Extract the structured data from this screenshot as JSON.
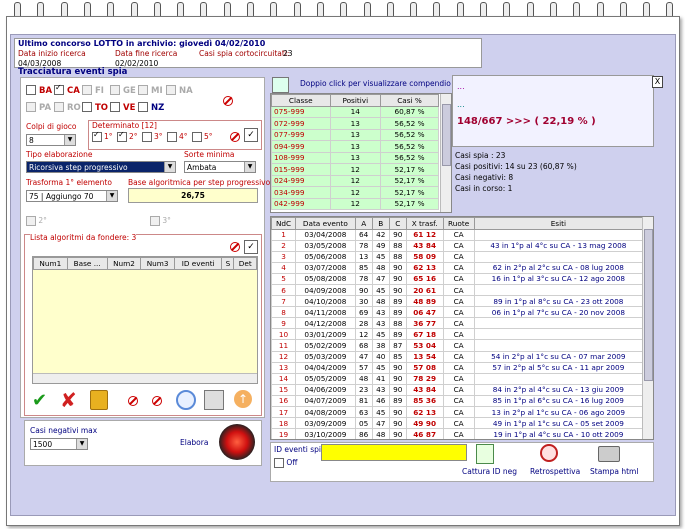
{
  "header": {
    "title": "Ultimo concorso LOTTO in archivio: giovedì 04/02/2010",
    "start_label": "Data inizio ricerca",
    "start_value": "04/03/2008",
    "end_label": "Data fine ricerca",
    "end_value": "02/02/2010",
    "short_label": "Casi spia cortocircuitati:",
    "short_value": "23"
  },
  "section_title": "Tracciatura eventi spia",
  "wheels_row1": [
    {
      "name": "BA",
      "checked": false,
      "active": true
    },
    {
      "name": "CA",
      "checked": true,
      "active": true
    },
    {
      "name": "FI",
      "checked": false,
      "active": false
    },
    {
      "name": "GE",
      "checked": false,
      "active": false
    },
    {
      "name": "MI",
      "checked": false,
      "active": false
    },
    {
      "name": "NA",
      "checked": false,
      "active": false
    }
  ],
  "wheels_row2": [
    {
      "name": "PA",
      "checked": false,
      "active": false
    },
    {
      "name": "RO",
      "checked": false,
      "active": false
    },
    {
      "name": "TO",
      "checked": false,
      "active": true
    },
    {
      "name": "VE",
      "checked": false,
      "active": true
    },
    {
      "name": "NZ",
      "checked": false,
      "active": true,
      "blue": true
    }
  ],
  "colpi_label": "Colpi di gioco",
  "colpi_value": "8",
  "determinato_label": "Determinato [12]",
  "determinato_opts": [
    {
      "label": "1°",
      "checked": true
    },
    {
      "label": "2°",
      "checked": true
    },
    {
      "label": "3°",
      "checked": false
    },
    {
      "label": "4°",
      "checked": false
    },
    {
      "label": "5°",
      "checked": false
    }
  ],
  "tipo_label": "Tipo elaborazione",
  "tipo_value": "Ricorsiva step progressivo",
  "sorte_label": "Sorte minima",
  "sorte_value": "Ambata",
  "trasforma_label": "Trasforma 1° elemento",
  "trasforma_value": "75 | Aggiungo 70",
  "base_label": "Base algoritmica per step progressivo",
  "base_value": "26,75",
  "opt2": "2°",
  "opt3": "3°",
  "lista_label": "Lista algoritmi da fondere: 3",
  "lista_cols": [
    "Num1",
    "Base ...",
    "Num2",
    "Num3",
    "ID eventi",
    "S",
    "Det"
  ],
  "casi_neg_label": "Casi negativi max",
  "casi_neg_value": "1500",
  "elabora_label": "Elabora",
  "compendio_label": "Doppio click per visualizzare compendio",
  "cls_cols": [
    "Classe",
    "Positivi",
    "Casi %"
  ],
  "cls_rows": [
    [
      "075-999",
      "14",
      "60,87 %"
    ],
    [
      "072-999",
      "13",
      "56,52 %"
    ],
    [
      "077-999",
      "13",
      "56,52 %"
    ],
    [
      "094-999",
      "13",
      "56,52 %"
    ],
    [
      "108-999",
      "13",
      "56,52 %"
    ],
    [
      "015-999",
      "12",
      "52,17 %"
    ],
    [
      "024-999",
      "12",
      "52,17 %"
    ],
    [
      "034-999",
      "12",
      "52,17 %"
    ],
    [
      "042-999",
      "12",
      "52,17 %"
    ]
  ],
  "summary": {
    "dots1": "...",
    "dots2": "...",
    "result": "148/667 >>> ( 22,19 % )",
    "close": "X"
  },
  "stats": [
    "Casi spia : 23",
    "Casi positivi: 14 su 23 (60,87 %)",
    "Casi negativi: 8",
    "Casi in corso: 1"
  ],
  "ev_cols": [
    "NdC",
    "Data evento",
    "A",
    "B",
    "C",
    "X trasf.",
    "Ruote",
    "Esiti"
  ],
  "ev_rows": [
    [
      "1",
      "03/04/2008",
      "64",
      "42",
      "90",
      "61 12",
      "CA",
      ""
    ],
    [
      "2",
      "03/05/2008",
      "78",
      "49",
      "88",
      "43 84",
      "CA",
      "43 in 1°p al 4°c su CA - 13 mag 2008"
    ],
    [
      "3",
      "05/06/2008",
      "13",
      "45",
      "88",
      "58 09",
      "CA",
      ""
    ],
    [
      "4",
      "03/07/2008",
      "85",
      "48",
      "90",
      "62 13",
      "CA",
      "62 in 2°p al 2°c su CA - 08 lug 2008"
    ],
    [
      "5",
      "05/08/2008",
      "78",
      "47",
      "90",
      "65 16",
      "CA",
      "16 in 1°p al 3°c su CA - 12 ago 2008"
    ],
    [
      "6",
      "04/09/2008",
      "90",
      "45",
      "90",
      "20 61",
      "CA",
      ""
    ],
    [
      "7",
      "04/10/2008",
      "30",
      "48",
      "89",
      "48 89",
      "CA",
      "89 in 1°p al 8°c su CA - 23 ott 2008"
    ],
    [
      "8",
      "04/11/2008",
      "69",
      "43",
      "89",
      "06 47",
      "CA",
      "06 in 1°p al 7°c su CA - 20 nov 2008"
    ],
    [
      "9",
      "04/12/2008",
      "28",
      "43",
      "88",
      "36 77",
      "CA",
      ""
    ],
    [
      "10",
      "03/01/2009",
      "12",
      "45",
      "89",
      "67 18",
      "CA",
      ""
    ],
    [
      "11",
      "05/02/2009",
      "68",
      "38",
      "87",
      "53 04",
      "CA",
      ""
    ],
    [
      "12",
      "05/03/2009",
      "47",
      "40",
      "85",
      "13 54",
      "CA",
      "54 in 2°p al 1°c su CA - 07 mar 2009"
    ],
    [
      "13",
      "04/04/2009",
      "57",
      "45",
      "90",
      "57 08",
      "CA",
      "57 in 2°p al 5°c su CA - 11 apr 2009"
    ],
    [
      "14",
      "05/05/2009",
      "48",
      "41",
      "90",
      "78 29",
      "CA",
      ""
    ],
    [
      "15",
      "04/06/2009",
      "23",
      "43",
      "90",
      "43 84",
      "CA",
      "84 in 2°p al 4°c su CA - 13 giu 2009"
    ],
    [
      "16",
      "04/07/2009",
      "81",
      "46",
      "89",
      "85 36",
      "CA",
      "85 in 1°p al 6°c su CA - 16 lug 2009"
    ],
    [
      "17",
      "04/08/2009",
      "63",
      "45",
      "90",
      "62 13",
      "CA",
      "13 in 2°p al 1°c su CA - 06 ago 2009"
    ],
    [
      "18",
      "03/09/2009",
      "05",
      "47",
      "90",
      "49 90",
      "CA",
      "49 in 1°p al 1°c su CA - 05 set 2009"
    ],
    [
      "19",
      "03/10/2009",
      "86",
      "48",
      "90",
      "46 87",
      "CA",
      "19 in 1°p al 4°c su CA - 10 ott 2009"
    ]
  ],
  "id_eventi_label": "ID eventi spia",
  "off_label": "Off",
  "btn_cattura": "Cattura ID neg",
  "btn_retro": "Retrospettiva",
  "btn_stampa": "Stampa html"
}
